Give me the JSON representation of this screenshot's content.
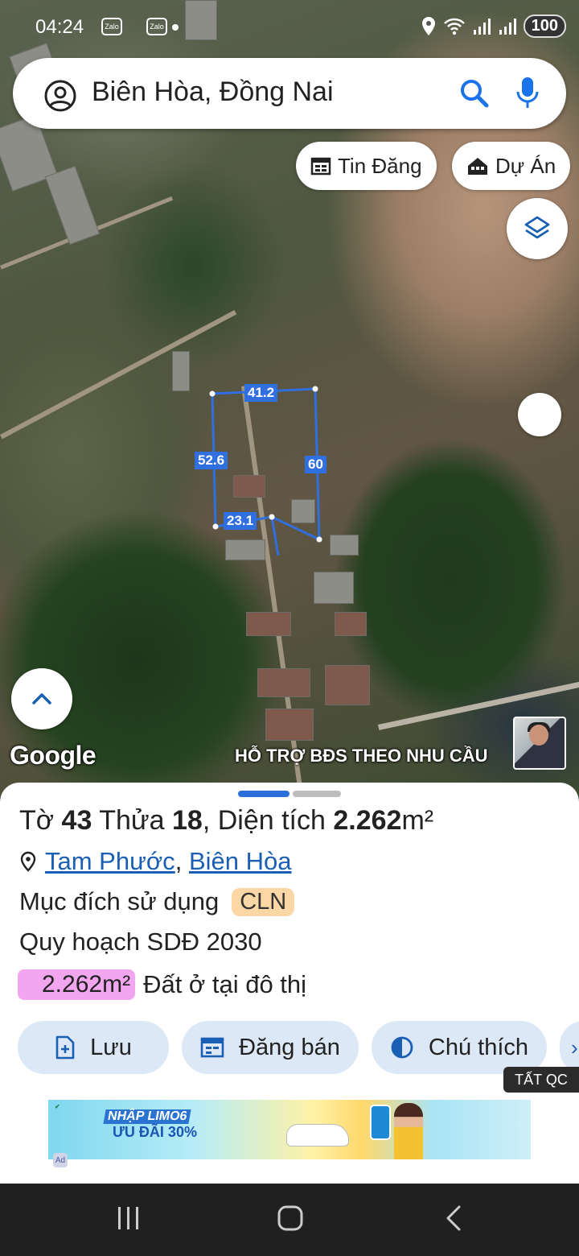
{
  "status_bar": {
    "time": "04:24",
    "app_icon_1": "Zalo",
    "app_icon_2": "Zalo",
    "battery": "100",
    "icons": [
      "location-icon",
      "wifi-icon",
      "signal-icon",
      "signal-icon",
      "battery-icon"
    ]
  },
  "search": {
    "query": "Biên Hòa, Đồng Nai"
  },
  "chips": {
    "tin_dang": "Tin Đăng",
    "du_an": "Dự Án"
  },
  "map": {
    "dimensions": {
      "top": "41.2",
      "left": "52.6",
      "right": "60",
      "bottom": "23.1"
    },
    "parcel_color": "#2f6fe0",
    "google_logo": "Google",
    "promo_text": "HỖ TRỢ BĐS  THEO NHU CẦU"
  },
  "parcel_info": {
    "title_prefix": "Tờ",
    "sheet_number": "43",
    "plot_label": "Thửa",
    "plot_number": "18",
    "area_label": ", Diện tích",
    "area_value": "2.262",
    "area_unit": "m²",
    "ward": "Tam Phước",
    "separator": ",",
    "city": "Biên Hòa",
    "purpose_label": "Mục đích sử dụng",
    "purpose_code": "CLN",
    "plan_label": "Quy hoạch SDĐ 2030",
    "plan_area": "2.262m²",
    "plan_use": "Đất ở tại đô thị",
    "plan_area_color": "#f3a6f0",
    "purpose_badge_color": "#fbd7a6"
  },
  "actions": {
    "save": "Lưu",
    "post_sale": "Đăng bán",
    "legend": "Chú thích"
  },
  "ad": {
    "hide_label": "TẤT QC",
    "headline_1": "NHẬP LIMO6",
    "headline_2": "ƯU ĐÃI 30%",
    "badge": "Ad"
  },
  "nav": {
    "icons": [
      "recent-apps-icon",
      "home-icon",
      "back-icon"
    ]
  }
}
